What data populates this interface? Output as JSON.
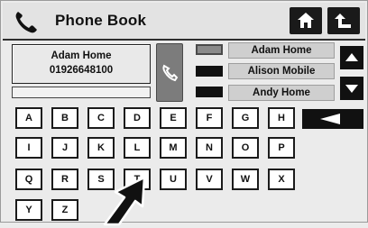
{
  "header": {
    "title": "Phone Book",
    "icons": [
      "phone-icon",
      "home-icon",
      "back-icon"
    ]
  },
  "contact": {
    "name": "Adam Home",
    "number": "01926648100"
  },
  "list": {
    "entries": [
      {
        "label": "Adam Home",
        "selected": true
      },
      {
        "label": "Alison Mobile",
        "selected": false
      },
      {
        "label": "Andy Home",
        "selected": false
      }
    ]
  },
  "keyboard": {
    "rows": [
      [
        "A",
        "B",
        "C",
        "D",
        "E",
        "F",
        "G",
        "H"
      ],
      [
        "I",
        "J",
        "K",
        "L",
        "M",
        "N",
        "O",
        "P"
      ],
      [
        "Q",
        "R",
        "S",
        "T",
        "U",
        "V",
        "W",
        "X"
      ],
      [
        "Y",
        "Z"
      ]
    ]
  },
  "colors": {
    "key_border": "#1b1b1b",
    "list_bg": "#cfcfcf",
    "selected_tick": "#8a8a8a",
    "call_button": "#7c7c7c"
  }
}
